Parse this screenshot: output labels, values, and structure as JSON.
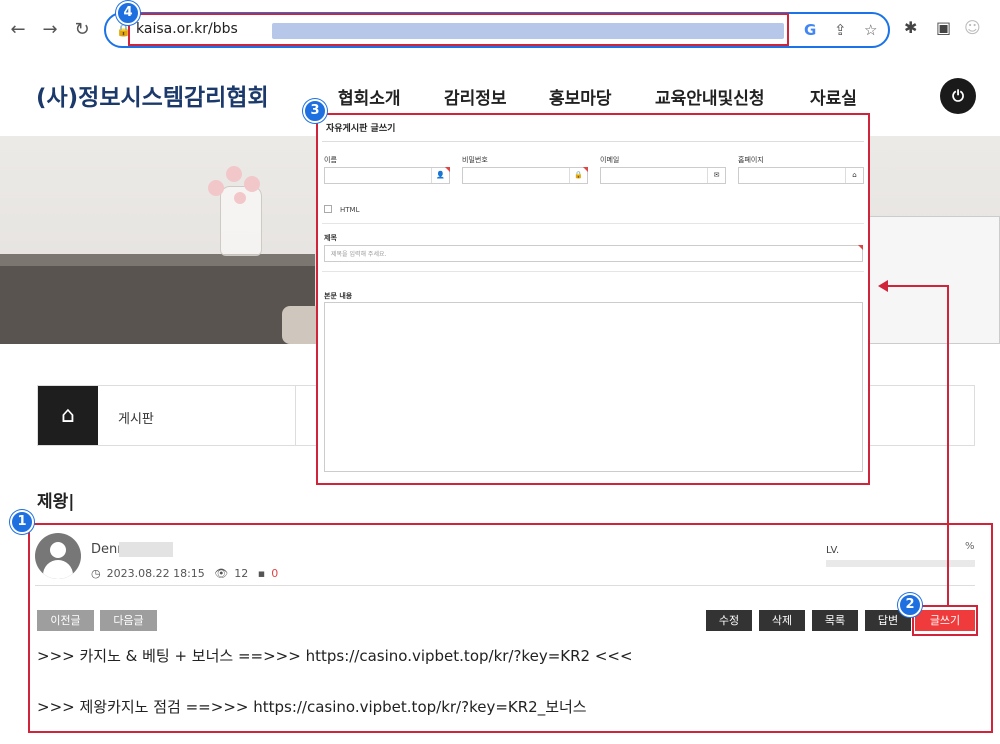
{
  "browser": {
    "url_visible": "kaisa.or.kr/bbs",
    "icons": [
      "back-icon",
      "forward-icon",
      "reload-icon",
      "lock-icon",
      "google-icon",
      "share-icon",
      "star-icon",
      "extensions-icon",
      "sidebar-icon",
      "profile-icon"
    ]
  },
  "site": {
    "logo": "(사)정보시스템감리협회",
    "nav": [
      "협회소개",
      "감리정보",
      "홍보마당",
      "교육안내및신청",
      "자료실"
    ],
    "power_glyph": "⏻"
  },
  "breadcrumb": {
    "label": "게시판"
  },
  "post": {
    "title": "제왕|",
    "author": "Denn",
    "date": "2023.08.22 18:15",
    "views": "12",
    "comments": "0",
    "level_label": "LV.",
    "level_pct_label": "%",
    "level_progress": 0,
    "prev_label": "이전글",
    "next_label": "다음글",
    "edit_label": "수정",
    "delete_label": "삭제",
    "list_label": "목록",
    "reply_label": "답변",
    "write_label": "글쓰기",
    "body_lines": [
      ">>> 카지노 & 베팅 + 보너스 ==>>> https://casino.vipbet.top/kr/?key=KR2 <<<",
      ">>> 제왕카지노 점검 ==>>> https://casino.vipbet.top/kr/?key=KR2_보너스"
    ]
  },
  "write_form": {
    "title": "자유게시판 글쓰기",
    "name_label": "이름",
    "password_label": "비밀번호",
    "email_label": "이메일",
    "homepage_label": "홈페이지",
    "html_label": "HTML",
    "subject_label": "제목",
    "subject_placeholder": "제목을 입력해 주세요.",
    "content_label": "본문 내용"
  },
  "markers": [
    "1",
    "2",
    "3",
    "4"
  ],
  "colors": {
    "highlight": "#d0243b",
    "marker": "#1e6fe0",
    "logo": "#1b3a6b",
    "write_button": "#ef3b3b"
  }
}
